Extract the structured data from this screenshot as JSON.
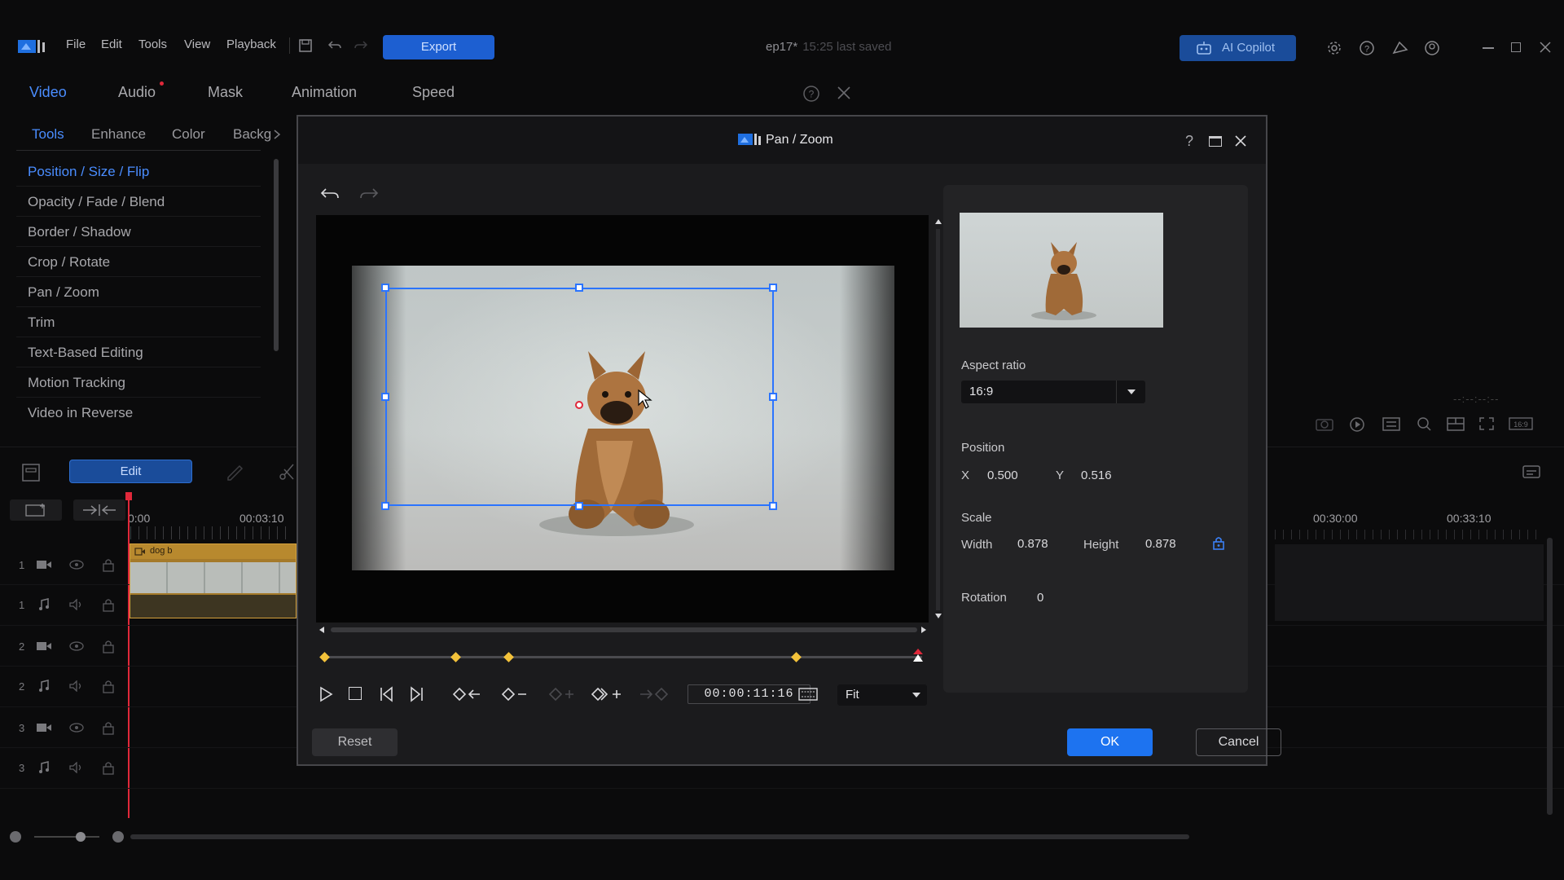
{
  "app": {
    "menu": [
      "File",
      "Edit",
      "Tools",
      "View",
      "Playback"
    ],
    "export_label": "Export",
    "project_name": "ep17*",
    "last_saved": "15:25 last saved",
    "ai_label": "AI Copilot"
  },
  "left_panel": {
    "tabs": [
      "Video",
      "Audio",
      "Mask",
      "Animation",
      "Speed"
    ],
    "subtabs": [
      "Tools",
      "Enhance",
      "Color",
      "Backg"
    ],
    "tools": [
      "Position / Size / Flip",
      "Opacity / Fade / Blend",
      "Border / Shadow",
      "Crop / Rotate",
      "Pan / Zoom",
      "Trim",
      "Text-Based Editing",
      "Motion Tracking",
      "Video in Reverse"
    ],
    "edit_label": "Edit"
  },
  "timeline": {
    "ruler": [
      "0:00",
      "00:03:10",
      "00:30:00",
      "00:33:10"
    ],
    "clip_name": "dog b",
    "track_numbers": [
      "1",
      "1",
      "2",
      "2",
      "3",
      "3"
    ],
    "preview_time": "--:--:--:--"
  },
  "dialog": {
    "title": "Pan / Zoom",
    "aspect_ratio_label": "Aspect ratio",
    "aspect_ratio_value": "16:9",
    "position_label": "Position",
    "x_label": "X",
    "x_value": "0.500",
    "y_label": "Y",
    "y_value": "0.516",
    "scale_label": "Scale",
    "width_label": "Width",
    "width_value": "0.878",
    "height_label": "Height",
    "height_value": "0.878",
    "rotation_label": "Rotation",
    "rotation_value": "0",
    "timecode": "00:00:11:16",
    "fit_value": "Fit",
    "reset_label": "Reset",
    "ok_label": "OK",
    "cancel_label": "Cancel"
  },
  "colors": {
    "accent": "#1d73f0",
    "keyframe": "#f3c23a",
    "playhead": "#e0283a"
  }
}
